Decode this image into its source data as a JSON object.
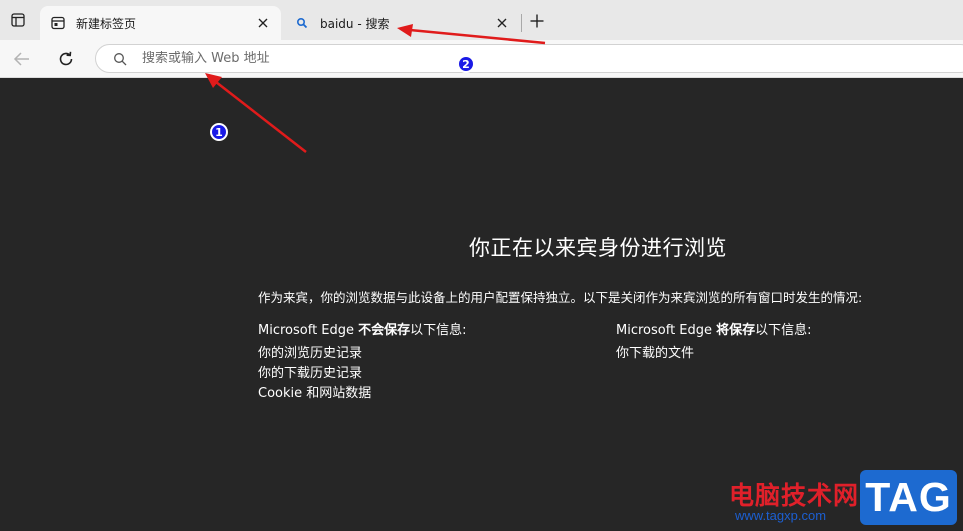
{
  "tabstrip": {
    "tab_actions_icon": "tab-actions-icon",
    "tabs": [
      {
        "title": "新建标签页",
        "icon": "new-tab-page-icon",
        "active": true
      },
      {
        "title": "baidu - 搜索",
        "icon": "search-icon",
        "active": false
      }
    ],
    "new_tab_icon": "plus-icon"
  },
  "toolbar": {
    "back_icon": "back-arrow-icon",
    "refresh_icon": "refresh-icon",
    "address_bar": {
      "icon": "search-icon",
      "placeholder": "搜索或输入 Web 地址",
      "value": ""
    }
  },
  "page": {
    "title": "你正在以来宾身份进行浏览",
    "intro": "作为来宾，你的浏览数据与此设备上的用户配置保持独立。以下是关闭作为来宾浏览的所有窗口时发生的情况:",
    "not_saved": {
      "head_prefix": "Microsoft Edge ",
      "head_bold": "不会保存",
      "head_suffix": "以下信息:",
      "items": [
        "你的浏览历史记录",
        "你的下载历史记录",
        "Cookie 和网站数据"
      ]
    },
    "saved": {
      "head_prefix": "Microsoft Edge ",
      "head_bold": "将保存",
      "head_suffix": "以下信息:",
      "items": [
        "你下载的文件"
      ]
    }
  },
  "annotations": {
    "badge_1": "1",
    "badge_2": "2",
    "arrow_color": "#e01b1b"
  },
  "watermark": {
    "site_name": "电脑技术网",
    "url": "www.tagxp.com",
    "logo": "TAG",
    "brand_color": "#1d6ad0"
  }
}
